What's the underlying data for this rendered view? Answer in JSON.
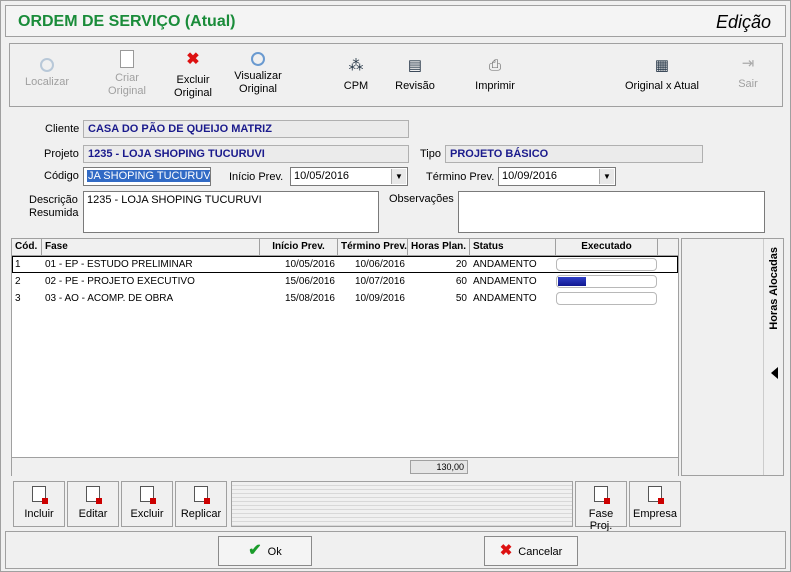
{
  "window": {
    "title": "ORDEM DE SERVIÇO (Atual)",
    "mode": "Edição"
  },
  "toolbar": {
    "localizar": "Localizar",
    "criar_original": [
      "Criar",
      "Original"
    ],
    "excluir_original": [
      "Excluir",
      "Original"
    ],
    "visualizar_original": [
      "Visualizar",
      "Original"
    ],
    "cpm": "CPM",
    "revisao": "Revisão",
    "imprimir": "Imprimir",
    "original_atual": "Original x Atual",
    "sair": "Sair"
  },
  "form": {
    "cliente_label": "Cliente",
    "cliente_value": "CASA DO PÃO DE QUEIJO MATRIZ",
    "projeto_label": "Projeto",
    "projeto_value": "1235 - LOJA SHOPING TUCURUVI",
    "tipo_label": "Tipo",
    "tipo_value": "PROJETO BÁSICO",
    "codigo_label": "Código",
    "codigo_value": "JA SHOPING TUCURUVI",
    "inicio_label": "Início Prev.",
    "inicio_value": "10/05/2016",
    "termino_label": "Término Prev.",
    "termino_value": "10/09/2016",
    "descricao_label": [
      "Descrição",
      "Resumida"
    ],
    "descricao_value": "1235 - LOJA SHOPING TUCURUVI",
    "observacoes_label": "Observações",
    "observacoes_value": ""
  },
  "grid": {
    "headers": [
      "Cód.",
      "Fase",
      "Início Prev.",
      "Término Prev.",
      "Horas Plan.",
      "Status",
      "Executado"
    ],
    "rows": [
      {
        "cod": "1",
        "fase": "01 - EP - ESTUDO PRELIMINAR",
        "inicio": "10/05/2016",
        "termino": "10/06/2016",
        "horas": "20",
        "status": "ANDAMENTO",
        "executado": 0.0
      },
      {
        "cod": "2",
        "fase": "02 - PE - PROJETO EXECUTIVO",
        "inicio": "15/06/2016",
        "termino": "10/07/2016",
        "horas": "60",
        "status": "ANDAMENTO",
        "executado": 0.28
      },
      {
        "cod": "3",
        "fase": "03 - AO - ACOMP. DE OBRA",
        "inicio": "15/08/2016",
        "termino": "10/09/2016",
        "horas": "50",
        "status": "ANDAMENTO",
        "executado": 0.0
      }
    ],
    "total_horas": "130,00"
  },
  "side_panel": {
    "label": "Horas Alocadas"
  },
  "actions": {
    "incluir": "Incluir",
    "editar": "Editar",
    "excluir": "Excluir",
    "replicar": "Replicar",
    "fase_proj": "Fase Proj.",
    "empresa": "Empresa"
  },
  "footer": {
    "ok": "Ok",
    "cancelar": "Cancelar"
  },
  "colors": {
    "title_green": "#1a8c3a",
    "field_text": "#1a1a8c",
    "progress": "#101890"
  }
}
